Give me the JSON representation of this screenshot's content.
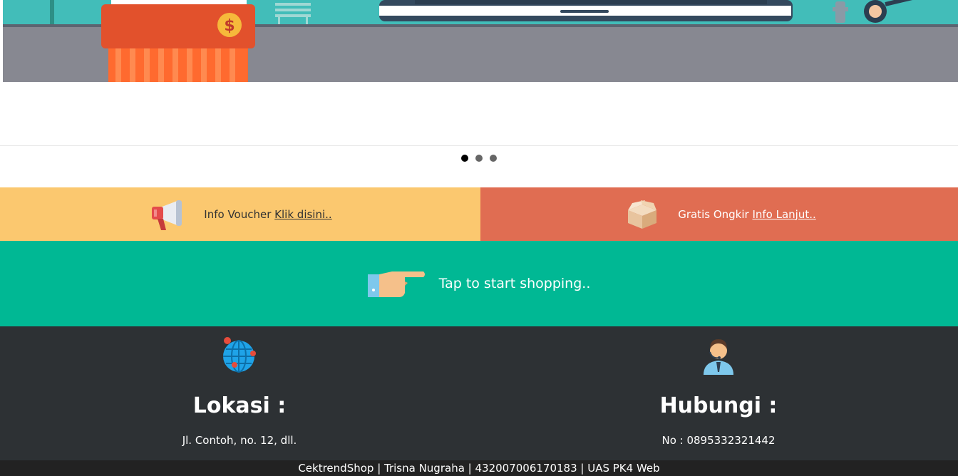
{
  "carousel": {
    "dots": 3,
    "active_index": 0
  },
  "promos": {
    "voucher": {
      "text": "Info Voucher ",
      "link": "Klik disini.."
    },
    "ongkir": {
      "text": "Gratis Ongkir ",
      "link": "Info Lanjut.."
    }
  },
  "cta": {
    "label": "Tap to start shopping.."
  },
  "footer": {
    "lokasi": {
      "title": "Lokasi :",
      "text": "Jl. Contoh, no. 12, dll."
    },
    "hubungi": {
      "title": "Hubungi :",
      "text": "No : 0895332321442"
    }
  },
  "bottom_bar": {
    "text": "CektrendShop | Trisna Nugraha | 432007006170183 | UAS PK4 Web"
  },
  "colors": {
    "voucher_bg": "#fbc86f",
    "ongkir_bg": "#e06d52",
    "cta_bg": "#00b894",
    "footer_bg": "#2d3134"
  }
}
